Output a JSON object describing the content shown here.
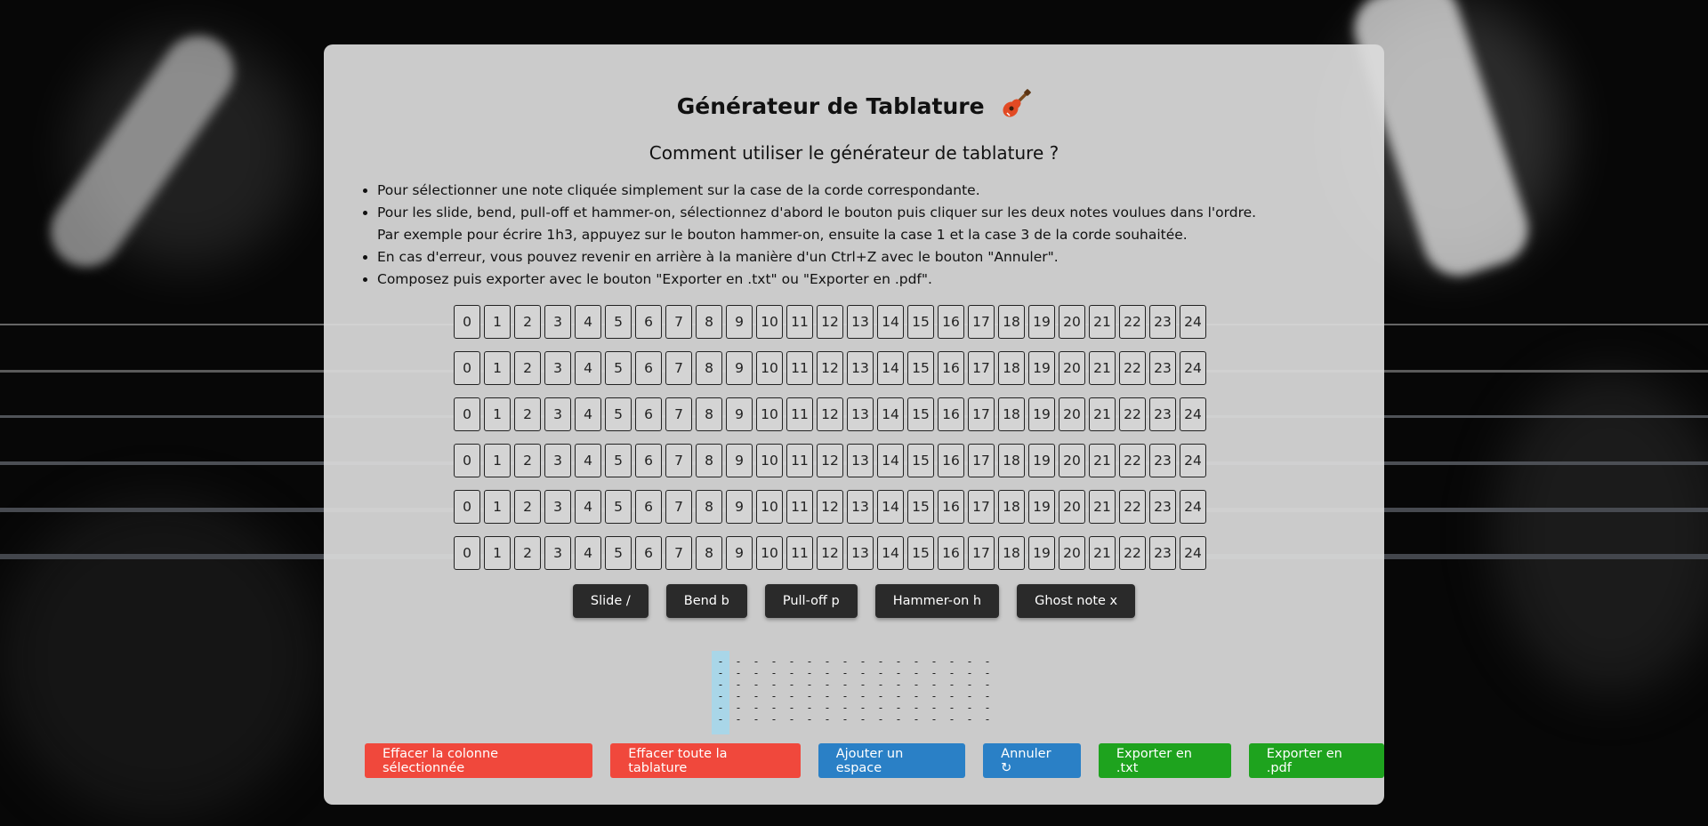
{
  "app": {
    "title": "Générateur de Tablature",
    "title_icon": "guitar-icon"
  },
  "help": {
    "heading": "Comment utiliser le générateur de tablature ?",
    "items": [
      "Pour sélectionner une note cliquée simplement sur la case de la corde correspondante.",
      "Pour les slide, bend, pull-off et hammer-on, sélectionnez d'abord le bouton puis cliquer sur les deux notes voulues dans l'ordre.",
      "Par exemple pour écrire 1h3, appuyez sur le bouton hammer-on, ensuite la case 1 et la case 3 de la corde souhaitée.",
      "En cas d'erreur, vous pouvez revenir en arrière à la manière d'un Ctrl+Z avec le bouton \"Annuler\".",
      "Composez puis exporter avec le bouton \"Exporter en .txt\" ou \"Exporter en .pdf\"."
    ]
  },
  "fretboard": {
    "strings": 6,
    "frets": [
      "0",
      "1",
      "2",
      "3",
      "4",
      "5",
      "6",
      "7",
      "8",
      "9",
      "10",
      "11",
      "12",
      "13",
      "14",
      "15",
      "16",
      "17",
      "18",
      "19",
      "20",
      "21",
      "22",
      "23",
      "24"
    ]
  },
  "techniques": [
    {
      "label": "Slide /",
      "name": "slide-button"
    },
    {
      "label": "Bend b",
      "name": "bend-button"
    },
    {
      "label": "Pull-off p",
      "name": "pull-off-button"
    },
    {
      "label": "Hammer-on h",
      "name": "hammer-on-button"
    },
    {
      "label": "Ghost note x",
      "name": "ghost-note-button"
    }
  ],
  "tab": {
    "columns": 16,
    "selected_column": 0,
    "empty_symbol": "-"
  },
  "actions": [
    {
      "label": "Effacer la colonne sélectionnée",
      "name": "clear-column-button",
      "color": "#f0483c"
    },
    {
      "label": "Effacer toute la tablature",
      "name": "clear-all-button",
      "color": "#f0483c"
    },
    {
      "label": "Ajouter un espace",
      "name": "add-space-button",
      "color": "#2a80c6"
    },
    {
      "label": "Annuler ↻",
      "name": "undo-button",
      "color": "#2a80c6"
    },
    {
      "label": "Exporter en .txt",
      "name": "export-txt-button",
      "color": "#1ea31e"
    },
    {
      "label": "Exporter en .pdf",
      "name": "export-pdf-button",
      "color": "#1ea31e"
    }
  ],
  "colors": {
    "card_bg": "#dadada",
    "fret_border": "#222222",
    "selected_column": "#a9d6e8"
  }
}
